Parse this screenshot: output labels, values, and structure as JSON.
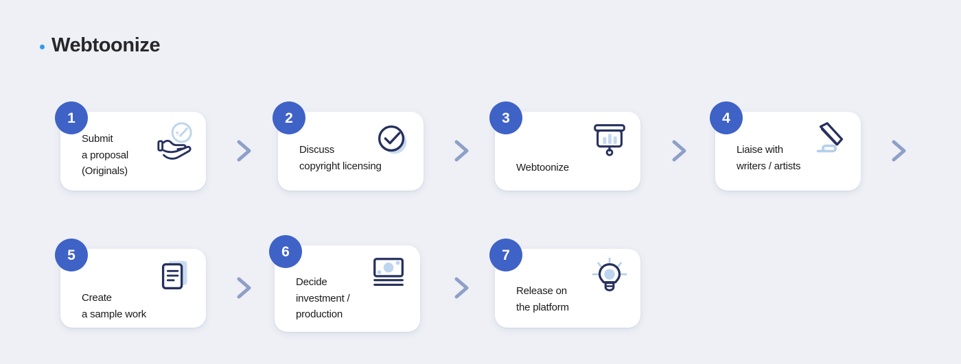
{
  "header": {
    "bullet_icon": "dot-icon",
    "title": "Webtoonize"
  },
  "colors": {
    "background": "#eef0f5",
    "card": "#ffffff",
    "badge": "#3f62c7",
    "accent_dot": "#2f9bf0",
    "icon_dark": "#27315e",
    "icon_light": "#b9d1ea",
    "chevron": "#8e9fc8",
    "text": "#191919"
  },
  "flow": {
    "rows": [
      {
        "cards": [
          {
            "number": "1",
            "label": "Submit\na proposal\n(Originals)",
            "icon": "hand-check-icon"
          },
          {
            "number": "2",
            "label": "Discuss\ncopyright licensing",
            "icon": "check-circle-icon"
          },
          {
            "number": "3",
            "label": "Webtoonize",
            "icon": "presentation-chart-icon"
          },
          {
            "number": "4",
            "label": "Liaise with\nwriters / artists",
            "icon": "pen-signature-icon"
          }
        ],
        "arrows": [
          "chevron-right-icon",
          "chevron-right-icon",
          "chevron-right-icon",
          "chevron-right-icon"
        ]
      },
      {
        "cards": [
          {
            "number": "5",
            "label": "Create\na sample work",
            "icon": "document-icon"
          },
          {
            "number": "6",
            "label": "Decide\ninvestment /\nproduction",
            "icon": "banknote-icon"
          },
          {
            "number": "7",
            "label": "Release on\nthe platform",
            "icon": "lightbulb-icon"
          }
        ],
        "arrows": [
          "chevron-right-icon",
          "chevron-right-icon"
        ]
      }
    ]
  }
}
